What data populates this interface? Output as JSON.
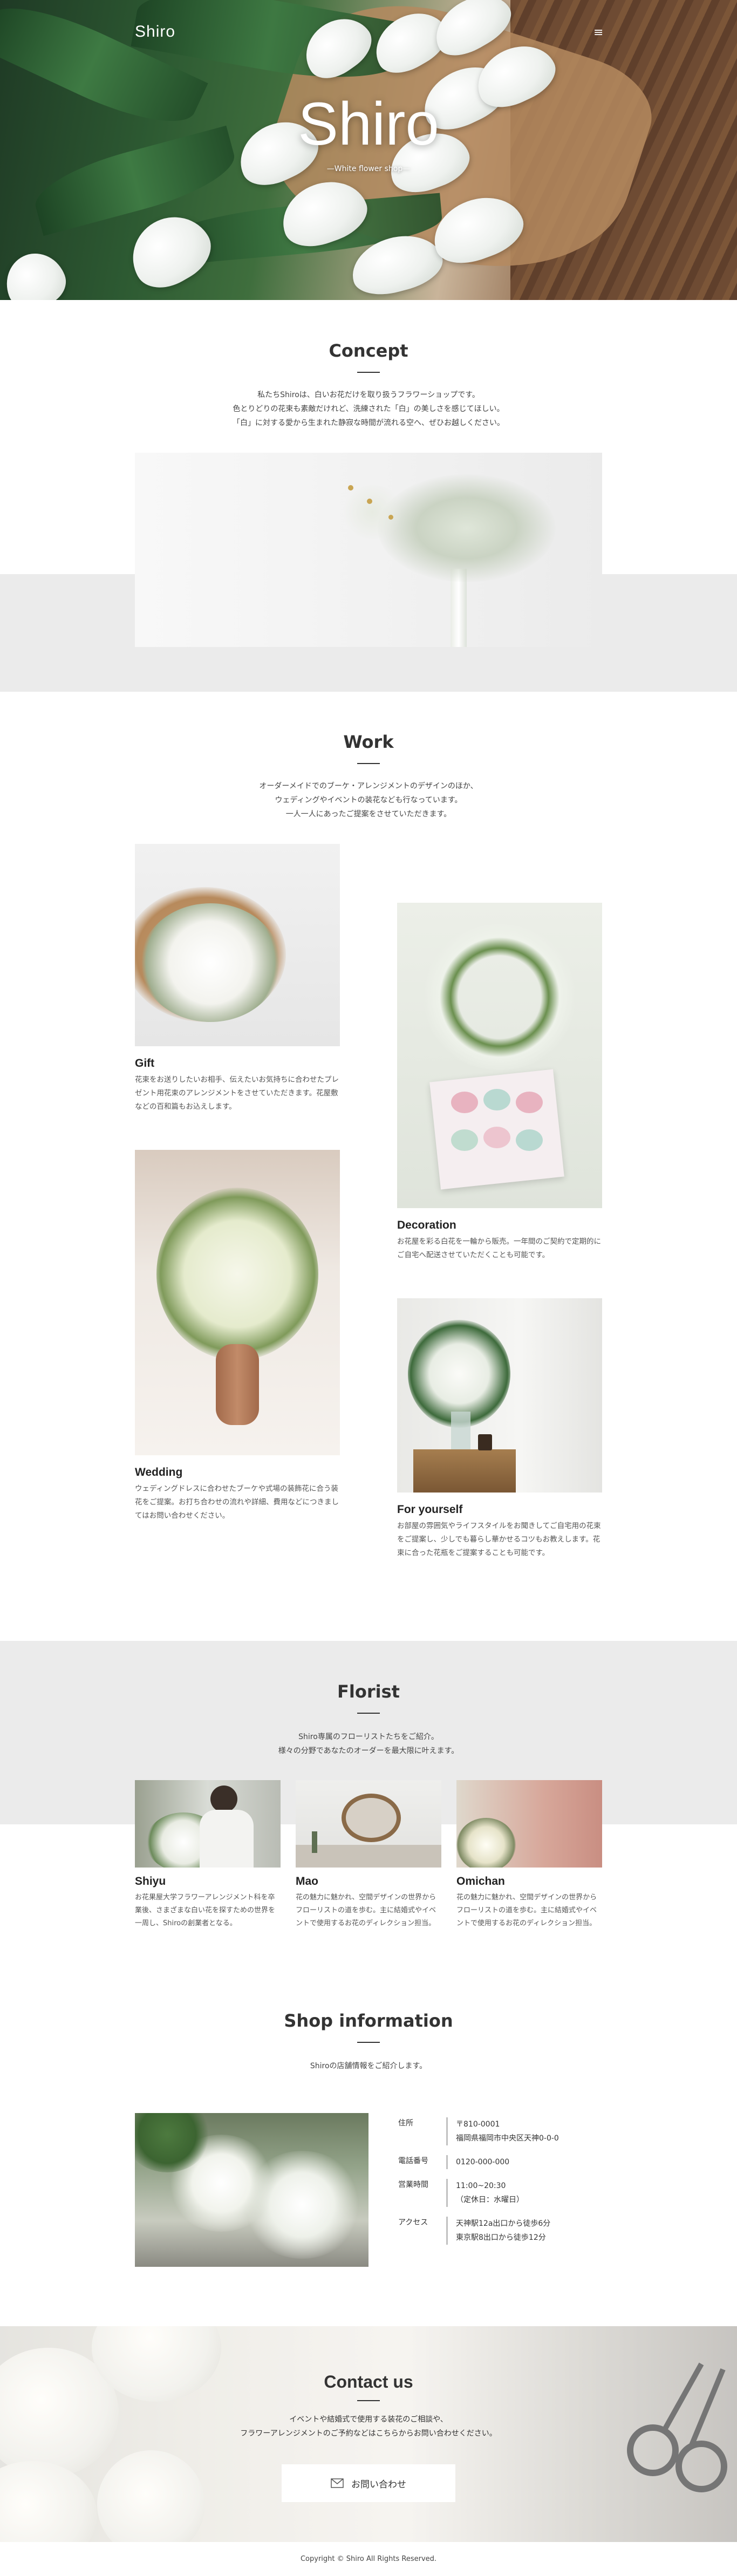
{
  "hero": {
    "logo": "Shiro",
    "title": "Shiro",
    "subtitle": "—White flower shop—",
    "menu_icon": "hamburger-icon",
    "menu_glyph": "≡"
  },
  "concept": {
    "title": "Concept",
    "lines": [
      "私たちShiroは、白いお花だけを取り扱うフラワーショップです。",
      "色とりどりの花束も素敵だけれど、洗練された「白」の美しさを感じてほしい。",
      "「白」に対する愛から生まれた静寂な時間が流れる空へ、ぜひお越しください。"
    ]
  },
  "work": {
    "title": "Work",
    "lines": [
      "オーダーメイドでのブーケ・アレンジメントのデザインのほか、",
      "ウェディングやイベントの装花なども行なっています。",
      "一人一人にあったご提案をさせていただきます。"
    ],
    "items": [
      {
        "label": "Gift",
        "desc": "花束をお送りしたいお相手、伝えたいお気持ちに合わせたプレゼント用花束のアレンジメントをさせていただきます。花屋敷などの百和篇もお込えします。"
      },
      {
        "label": "Decoration",
        "desc": "お花屋を彩る白花を一輪から販売。一年間のご契約で定期的にご自宅へ配送させていただくことも可能です。"
      },
      {
        "label": "Wedding",
        "desc": "ウェディングドレスに合わせたブーケや式場の装飾花に合う装花をご提案。お打ち合わせの流れや詳細、費用などにつきましてはお問い合わせください。"
      },
      {
        "label": "For yourself",
        "desc": "お部屋の雰囲気やライフスタイルをお聞きしてご自宅用の花束をご提案し、少しでも暮らし華かせるコツもお教えします。花束に合った花瓶をご提案することも可能です。"
      }
    ]
  },
  "florist": {
    "title": "Florist",
    "lines": [
      "Shiro専属のフローリストたちをご紹介。",
      "様々の分野であなたのオーダーを最大限に叶えます。"
    ],
    "members": [
      {
        "name": "Shiyu",
        "desc": "お花果屋大学フラワーアレンジメント科を卒業後、さまざまな白い花を探すための世界を一周し、Shiroの創業者となる。"
      },
      {
        "name": "Mao",
        "desc": "花の魅力に魅かれ、空間デザインの世界からフローリストの道を歩む。主に結婚式やイベントで使用するお花のディレクション担当。"
      },
      {
        "name": "Omichan",
        "desc": "花の魅力に魅かれ、空間デザインの世界からフローリストの道を歩む。主に結婚式やイベントで使用するお花のディレクション担当。"
      }
    ]
  },
  "shop": {
    "title": "Shop information",
    "text": "Shiroの店舗情報をご紹介します。",
    "rows": [
      {
        "label": "住所",
        "value": [
          "〒810-0001",
          "福岡県福岡市中央区天神0-0-0"
        ]
      },
      {
        "label": "電話番号",
        "value": [
          "0120-000-000"
        ]
      },
      {
        "label": "営業時間",
        "value": [
          "11:00~20:30",
          "（定休日：水曜日）"
        ]
      },
      {
        "label": "アクセス",
        "value": [
          "天神駅12a出口から徒歩6分",
          "東京駅8出口から徒歩12分"
        ]
      }
    ]
  },
  "contact": {
    "title": "Contact us",
    "lines": [
      "イベントや結婚式で使用する装花のご相談や、",
      "フラワーアレンジメントのご予約などはこちらからお問い合わせください。"
    ],
    "button_label": "お問い合わせ",
    "button_icon": "mail-icon"
  },
  "footer": {
    "copyright": "Copyright © Shiro All Rights Reserved."
  }
}
